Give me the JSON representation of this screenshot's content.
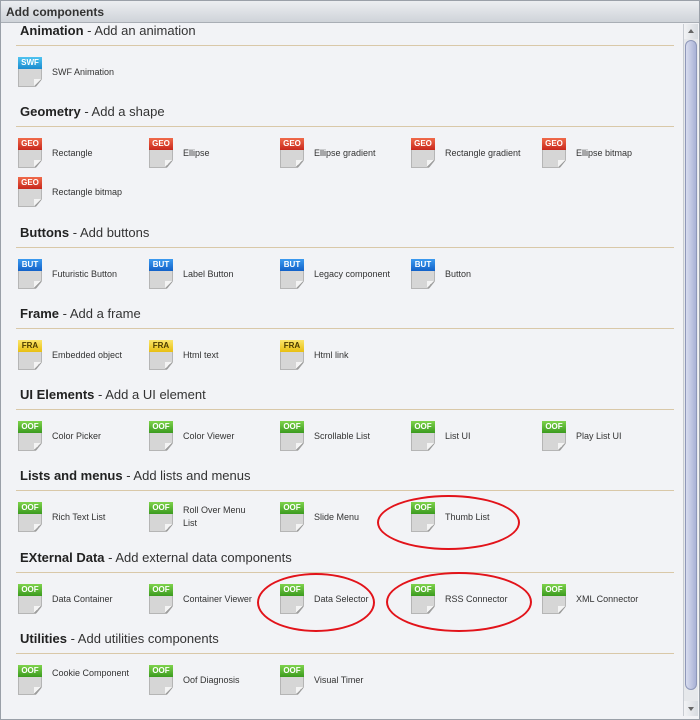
{
  "window": {
    "title": "Add components"
  },
  "sections": [
    {
      "title": "Animation",
      "desc": " - Add an animation",
      "items": [
        {
          "badge": "SWF",
          "label": "SWF Animation"
        }
      ]
    },
    {
      "title": "Geometry",
      "desc": " - Add a shape",
      "items": [
        {
          "badge": "GEO",
          "label": "Rectangle"
        },
        {
          "badge": "GEO",
          "label": "Ellipse"
        },
        {
          "badge": "GEO",
          "label": "Ellipse gradient"
        },
        {
          "badge": "GEO",
          "label": "Rectangle gradient"
        },
        {
          "badge": "GEO",
          "label": "Ellipse bitmap"
        },
        {
          "badge": "GEO",
          "label": "Rectangle bitmap"
        }
      ]
    },
    {
      "title": "Buttons",
      "desc": " - Add buttons",
      "items": [
        {
          "badge": "BUT",
          "label": "Futuristic Button"
        },
        {
          "badge": "BUT",
          "label": "Label Button"
        },
        {
          "badge": "BUT",
          "label": "Legacy component"
        },
        {
          "badge": "BUT",
          "label": "Button"
        }
      ]
    },
    {
      "title": "Frame",
      "desc": " - Add a frame",
      "items": [
        {
          "badge": "FRA",
          "label": "Embedded object"
        },
        {
          "badge": "FRA",
          "label": "Html text"
        },
        {
          "badge": "FRA",
          "label": "Html link"
        }
      ]
    },
    {
      "title": "UI Elements",
      "desc": " - Add a UI element",
      "items": [
        {
          "badge": "OOF",
          "label": "Color Picker"
        },
        {
          "badge": "OOF",
          "label": "Color Viewer"
        },
        {
          "badge": "OOF",
          "label": "Scrollable List"
        },
        {
          "badge": "OOF",
          "label": "List UI"
        },
        {
          "badge": "OOF",
          "label": "Play List UI"
        }
      ]
    },
    {
      "title": "Lists and menus",
      "desc": " - Add lists and menus",
      "items": [
        {
          "badge": "OOF",
          "label": "Rich Text List"
        },
        {
          "badge": "OOF",
          "label": "Roll Over Menu List"
        },
        {
          "badge": "OOF",
          "label": "Slide Menu"
        },
        {
          "badge": "OOF",
          "label": "Thumb List"
        }
      ]
    },
    {
      "title": "EXternal Data",
      "desc": " - Add external data components",
      "items": [
        {
          "badge": "OOF",
          "label": "Data Container"
        },
        {
          "badge": "OOF",
          "label": "Container Viewer"
        },
        {
          "badge": "OOF",
          "label": "Data Selector"
        },
        {
          "badge": "OOF",
          "label": "RSS Connector"
        },
        {
          "badge": "OOF",
          "label": "XML Connector"
        }
      ]
    },
    {
      "title": "Utilities",
      "desc": " - Add utilities components",
      "items": [
        {
          "badge": "OOF",
          "label": "Cookie Component"
        },
        {
          "badge": "OOF",
          "label": "Oof Diagnosis"
        },
        {
          "badge": "OOF",
          "label": "Visual Timer"
        }
      ]
    }
  ],
  "colors": {
    "highlight": "#e2131a",
    "rule": "#d9c8a8"
  }
}
